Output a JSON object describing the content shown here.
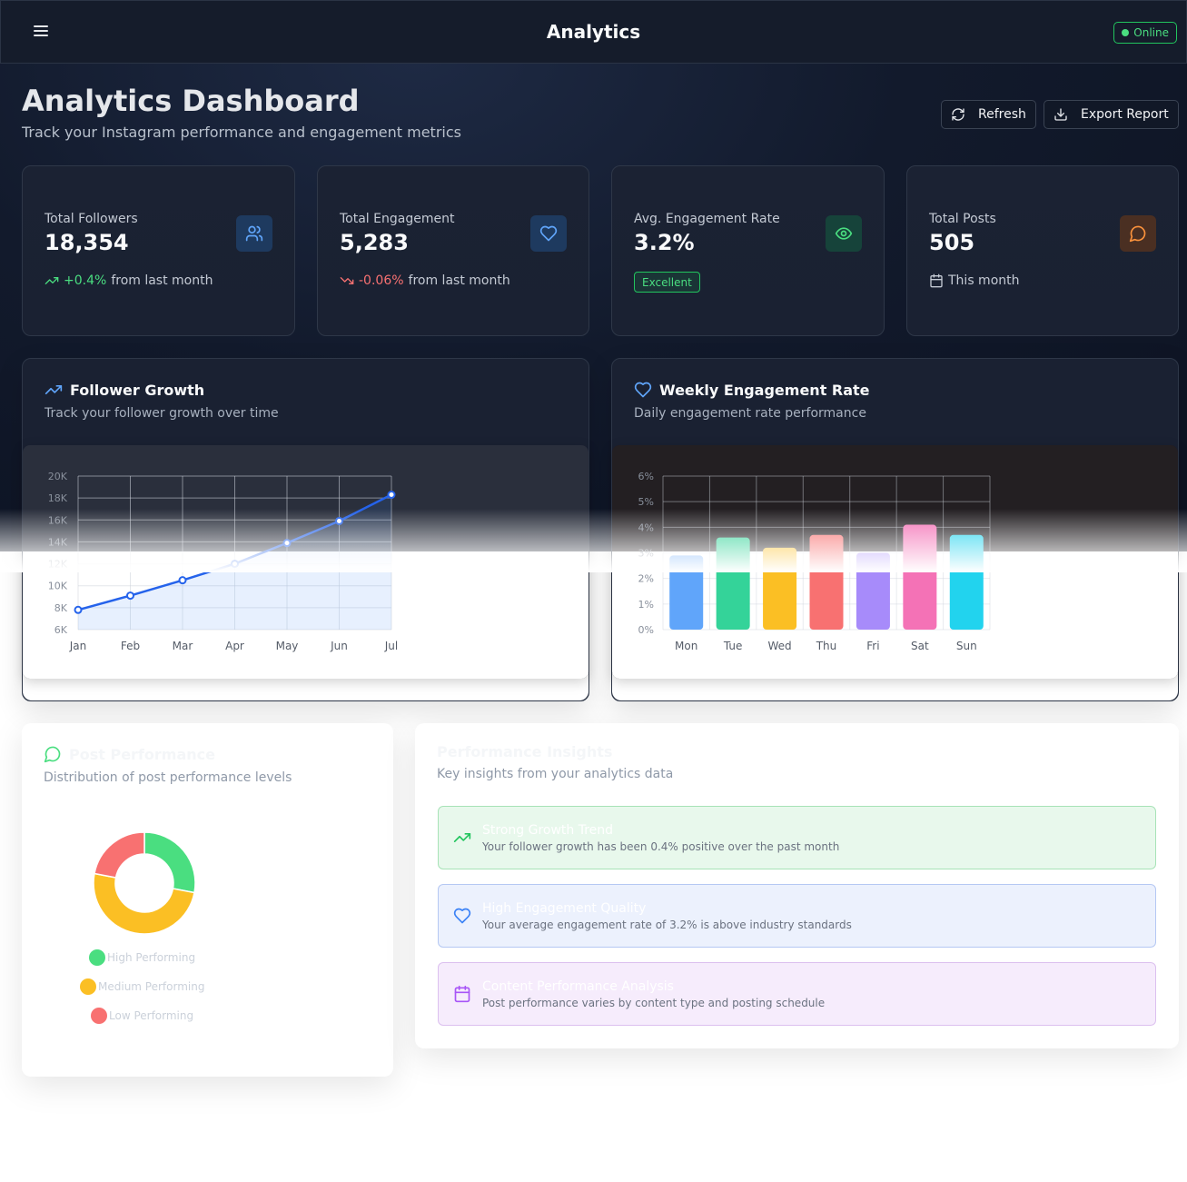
{
  "header": {
    "title": "Analytics",
    "status": "Online"
  },
  "page": {
    "title": "Analytics Dashboard",
    "subtitle": "Track your Instagram performance and engagement metrics",
    "refresh_label": "Refresh",
    "export_label": "Export Report"
  },
  "stats": [
    {
      "label": "Total Followers",
      "value": "18,354",
      "change": "+0.4%",
      "suffix": "from last month",
      "icon": "users-icon",
      "trend": "up"
    },
    {
      "label": "Total Engagement",
      "value": "5,283",
      "change": "-0.06%",
      "suffix": "from last month",
      "icon": "heart-icon",
      "trend": "down"
    },
    {
      "label": "Avg. Engagement Rate",
      "value": "3.2%",
      "badge": "Excellent",
      "icon": "eye-icon"
    },
    {
      "label": "Total Posts",
      "value": "505",
      "suffix": "This month",
      "icon": "message-icon"
    }
  ],
  "follower_growth": {
    "title": "Follower Growth",
    "description": "Track your follower growth over time"
  },
  "weekly_engagement": {
    "title": "Weekly Engagement Rate",
    "description": "Daily engagement rate performance"
  },
  "post_performance": {
    "title": "Post Performance",
    "description": "Distribution of post performance levels"
  },
  "insights": {
    "title": "Performance Insights",
    "description": "Key insights from your analytics data",
    "items": [
      {
        "title": "Strong Growth Trend",
        "text": "Your follower growth has been 0.4% positive over the past month",
        "icon": "trending-up-icon"
      },
      {
        "title": "High Engagement Quality",
        "text": "Your average engagement rate of 3.2% is above industry standards",
        "icon": "heart-icon"
      },
      {
        "title": "Content Performance Analysis",
        "text": "Post performance varies by content type and posting schedule",
        "icon": "calendar-icon"
      }
    ]
  },
  "colors": {
    "accent": "#3b82f6",
    "success": "#22c55e",
    "danger": "#ef4444",
    "warning": "#f59e0b"
  },
  "chart_data": [
    {
      "type": "line",
      "categories": [
        "Jan",
        "Feb",
        "Mar",
        "Apr",
        "May",
        "Jun",
        "Jul"
      ],
      "values": [
        7800,
        9100,
        10500,
        12000,
        13900,
        15900,
        18300
      ],
      "yticks": [
        "6K",
        "8K",
        "10K",
        "12K",
        "14K",
        "16K",
        "18K",
        "20K"
      ],
      "ylim": [
        6000,
        20000
      ],
      "grid": true
    },
    {
      "type": "bar",
      "categories": [
        "Mon",
        "Tue",
        "Wed",
        "Thu",
        "Fri",
        "Sat",
        "Sun"
      ],
      "values": [
        2.9,
        3.6,
        3.2,
        3.7,
        3.0,
        4.1,
        3.7
      ],
      "colors": [
        "#60a5fa",
        "#34d399",
        "#fbbf24",
        "#f87171",
        "#a78bfa",
        "#f472b6",
        "#22d3ee"
      ],
      "yticks": [
        "0%",
        "1%",
        "2%",
        "3%",
        "4%",
        "5%",
        "6%"
      ],
      "ylim": [
        0,
        6
      ],
      "grid": true
    },
    {
      "type": "pie",
      "labels": [
        "High Performing",
        "Medium Performing",
        "Low Performing"
      ],
      "values": [
        28,
        50,
        22
      ],
      "colors": [
        "#4ade80",
        "#fbbf24",
        "#f87171"
      ]
    }
  ]
}
